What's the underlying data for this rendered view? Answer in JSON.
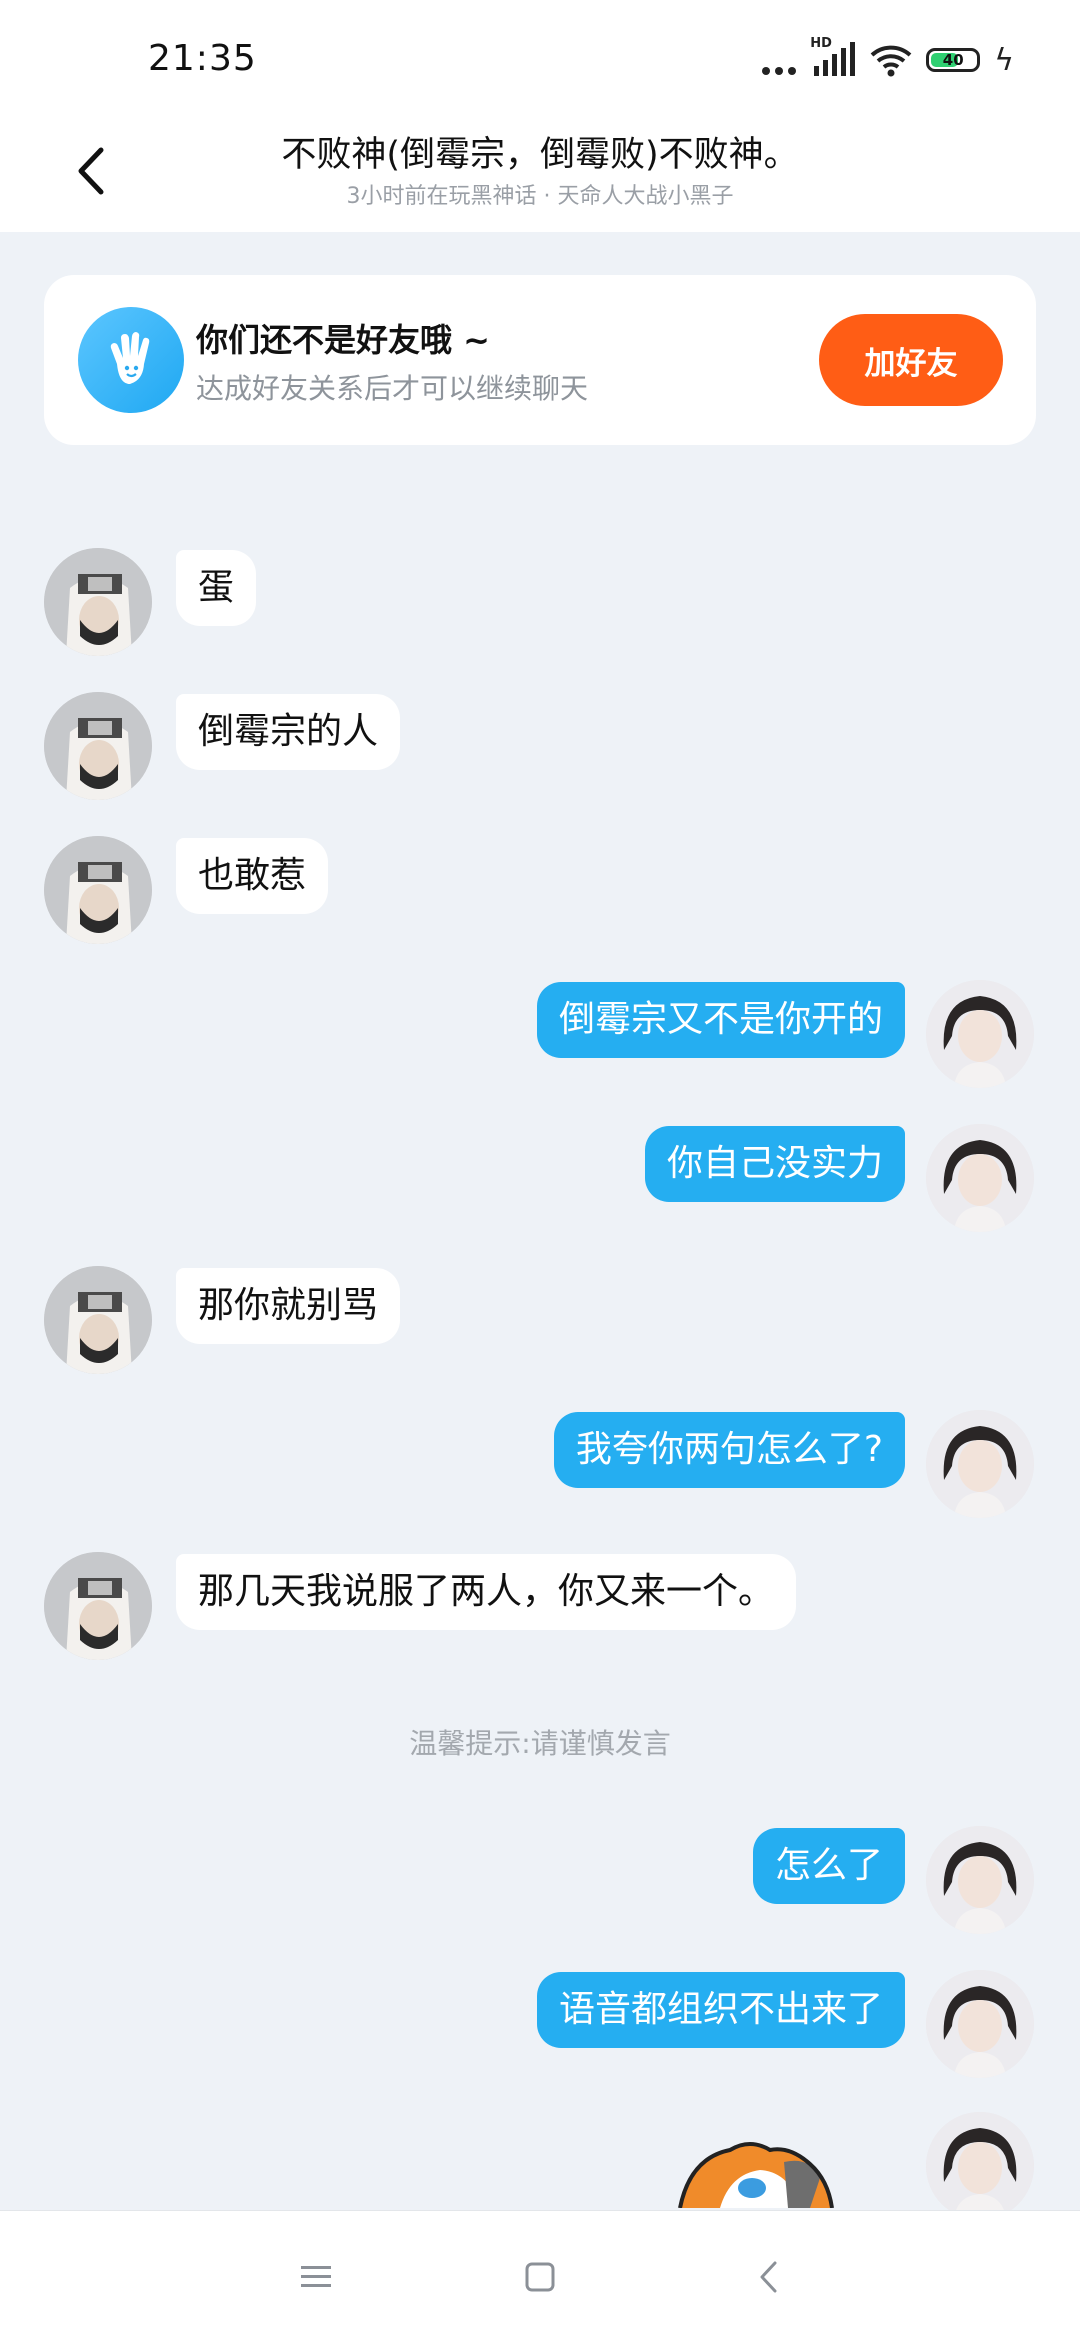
{
  "status_bar": {
    "time": "21:35",
    "network_label": "HD",
    "battery_level": "40"
  },
  "header": {
    "title": "不败神(倒霉宗，倒霉败)不败神。",
    "subtitle": "3小时前在玩黑神话 · 天命人大战小黑子"
  },
  "friend_card": {
    "title": "你们还不是好友哦 ~",
    "subtitle": "达成好友关系后才可以继续聊天",
    "button_label": "加好友"
  },
  "messages": [
    {
      "sender": "them",
      "text": "蛋"
    },
    {
      "sender": "them",
      "text": "倒霉宗的人"
    },
    {
      "sender": "them",
      "text": "也敢惹"
    },
    {
      "sender": "me",
      "text": "倒霉宗又不是你开的"
    },
    {
      "sender": "me",
      "text": "你自己没实力"
    },
    {
      "sender": "them",
      "text": "那你就别骂"
    },
    {
      "sender": "me",
      "text": "我夸你两句怎么了?"
    },
    {
      "sender": "them",
      "text": "那几天我说服了两人，你又来一个。"
    },
    {
      "sender": "me",
      "text": "怎么了"
    },
    {
      "sender": "me",
      "text": "语音都组织不出来了"
    }
  ],
  "system_tip": "温馨提示:请谨慎发言",
  "colors": {
    "accent_blue": "#25aef1",
    "add_friend_orange": "#ff5d15",
    "background": "#eef2f7"
  },
  "icons": {
    "back": "chevron-left-icon",
    "friend_card": "hand-wave-icon",
    "nav_menu": "menu-icon",
    "nav_home": "home-square-icon",
    "nav_back": "back-icon"
  }
}
